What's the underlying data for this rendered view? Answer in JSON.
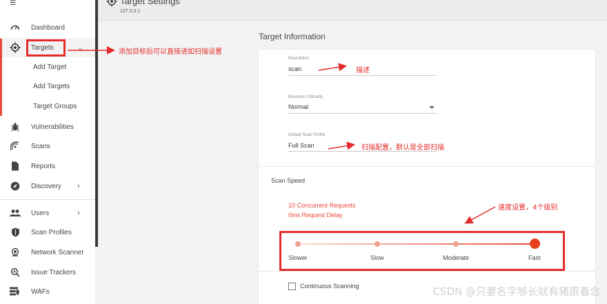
{
  "header": {
    "title": "Target Settings",
    "ip": "127.0.0.1"
  },
  "sidebar": {
    "items": [
      {
        "label": "Dashboard",
        "icon": "speedometer-icon"
      },
      {
        "label": "Targets",
        "icon": "crosshair-icon"
      },
      {
        "label": "Vulnerabilities",
        "icon": "bug-icon"
      },
      {
        "label": "Scans",
        "icon": "radar-icon"
      },
      {
        "label": "Reports",
        "icon": "document-icon"
      },
      {
        "label": "Discovery",
        "icon": "compass-icon"
      },
      {
        "label": "Users",
        "icon": "users-icon"
      },
      {
        "label": "Scan Profiles",
        "icon": "shield-icon"
      },
      {
        "label": "Network Scanner",
        "icon": "network-scanner-icon"
      },
      {
        "label": "Issue Trackers",
        "icon": "issue-tracker-icon"
      },
      {
        "label": "WAFs",
        "icon": "waf-icon"
      }
    ],
    "sub_items": [
      "Add Target",
      "Add Targets",
      "Target Groups"
    ]
  },
  "main": {
    "section_title": "Target Information",
    "description": {
      "label": "Description",
      "value": "scan"
    },
    "business_criticality": {
      "label": "Business Criticality",
      "value": "Normal"
    },
    "scan_profile": {
      "label": "Default Scan Profile",
      "value": "Full Scan"
    },
    "scan_speed": {
      "title": "Scan Speed",
      "requests": "10 Concurrent Requests",
      "delay": "0ms Request Delay",
      "levels": [
        "Slower",
        "Slow",
        "Moderate",
        "Fast"
      ],
      "selected": "Fast"
    },
    "continuous_scanning": {
      "label": "Continuous Scanning",
      "checked": false
    }
  },
  "annotations": {
    "targets": "添加目标后可以直接进如扫描设置",
    "description": "描述",
    "profile": "扫描配置，默认是全部扫描",
    "speed": "速度设置，4个级别",
    "color": "#e42b2b"
  },
  "watermark": "CSDN @只要名字够长就有猪跟着念",
  "colors": {
    "accent": "#e84a3a",
    "sidebar_bg": "#ffffff",
    "page_bg": "#f3f3f3"
  }
}
